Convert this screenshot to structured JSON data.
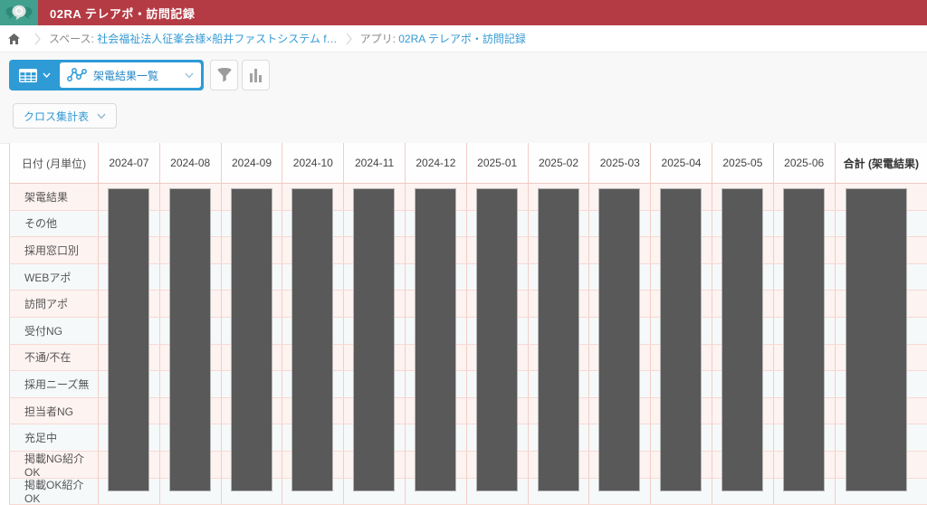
{
  "app_header": {
    "title": "02RA テレアポ・訪問記録",
    "logo_icon": "kintone-people-bubbles-icon"
  },
  "breadcrumb": {
    "home_icon": "home-icon",
    "space_label": "スペース: ",
    "space_link": "社会福祉法人征峯会様×船井ファストシステム f…",
    "app_label": "アプリ: ",
    "app_link": "02RA テレアポ・訪問記録"
  },
  "toolbar": {
    "view_mode_icon": "table-grid-icon",
    "view_type_icon": "line-chart-icon",
    "view_name": "架電結果一覧",
    "filter_icon": "funnel-icon",
    "chart_icon": "bar-chart-icon"
  },
  "crosstab_button": {
    "label": "クロス集計表"
  },
  "table": {
    "corner_header": "日付 (月単位)",
    "month_columns": [
      "2024-07",
      "2024-08",
      "2024-09",
      "2024-10",
      "2024-11",
      "2024-12",
      "2025-01",
      "2025-02",
      "2025-03",
      "2025-04",
      "2025-05",
      "2025-06"
    ],
    "total_header": "合計 (架電結果)",
    "row_labels": [
      "架電結果",
      "その他",
      "採用窓口別",
      "WEBアポ",
      "訪問アポ",
      "受付NG",
      "不通/不在",
      "採用ニーズ無",
      "担当者NG",
      "充足中",
      "掲載NG紹介OK",
      "掲載OK紹介OK"
    ],
    "data_redacted": true,
    "redaction_note": "all data cells covered by dark gray bars"
  },
  "colors": {
    "header_red": "#b43b43",
    "logo_teal": "#41a08e",
    "accent_blue": "#2e9bd6",
    "link_blue": "#3599d4",
    "grid_pink_line": "#f3cdc7",
    "row_pink": "#fdf3f1",
    "row_pale_blue": "#f6f9fa",
    "redaction_bar": "#595959"
  }
}
